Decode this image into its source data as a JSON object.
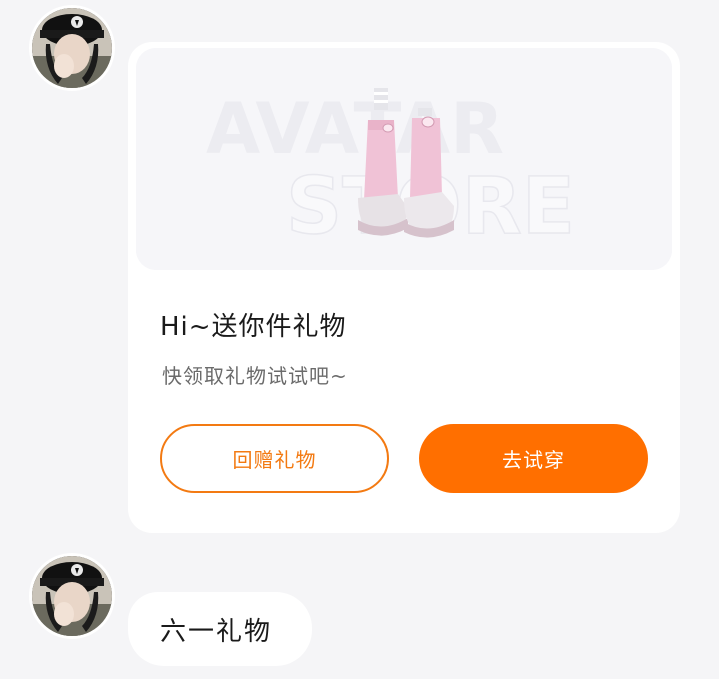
{
  "messages": [
    {
      "type": "gift-card",
      "banner": {
        "watermark_line1": "AVATAR",
        "watermark_line2": "STORE"
      },
      "title": "Hi~送你件礼物",
      "subtitle": "快领取礼物试试吧~",
      "buttons": {
        "return_gift": "回赠礼物",
        "try_on": "去试穿"
      }
    },
    {
      "type": "text",
      "text": "六一礼物"
    }
  ],
  "colors": {
    "accent": "#ff6f00",
    "accent_outline": "#f37a12",
    "background": "#f5f5f7",
    "card": "#ffffff",
    "title_text": "#1a1a1a",
    "sub_text": "#6b6b6b"
  },
  "icons": {
    "avatar": "user-avatar-photo",
    "banner_item": "pink-socks-sneakers"
  }
}
